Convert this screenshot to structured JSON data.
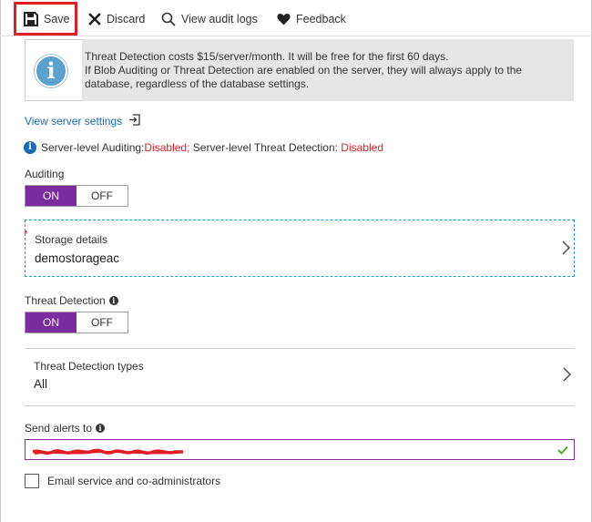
{
  "toolbar": {
    "save_label": "Save",
    "discard_label": "Discard",
    "audit_logs_label": "View audit logs",
    "feedback_label": "Feedback"
  },
  "info_banner": {
    "line1": "Threat Detection costs $15/server/month. It will be free for the first 60 days.",
    "line2": "If Blob Auditing or Threat Detection are enabled on the server, they will always apply to the database, regardless of the database settings."
  },
  "server_settings_link": "View server settings",
  "server_status": {
    "auditing_label": "Server-level Auditing: ",
    "auditing_value": "Disabled",
    "separator": ";",
    "threat_label": " Server-level Threat Detection: ",
    "threat_value": "Disabled"
  },
  "auditing": {
    "label": "Auditing",
    "on_label": "ON",
    "off_label": "OFF",
    "selected": "ON"
  },
  "storage": {
    "required_mark": "*",
    "label": "Storage details",
    "value": "demostorageac"
  },
  "threat_detection": {
    "label": "Threat Detection",
    "on_label": "ON",
    "off_label": "OFF",
    "selected": "ON"
  },
  "threat_types": {
    "label": "Threat Detection types",
    "value": "All"
  },
  "send_alerts": {
    "label": "Send alerts to",
    "value_redacted": true
  },
  "email_admins": {
    "label": "Email service and co-administrators",
    "checked": false
  },
  "colors": {
    "accent_purple": "#7a2b9f",
    "link_blue": "#1a6bb5",
    "highlight_red": "#e21d25",
    "valid_green": "#5aa82a"
  }
}
